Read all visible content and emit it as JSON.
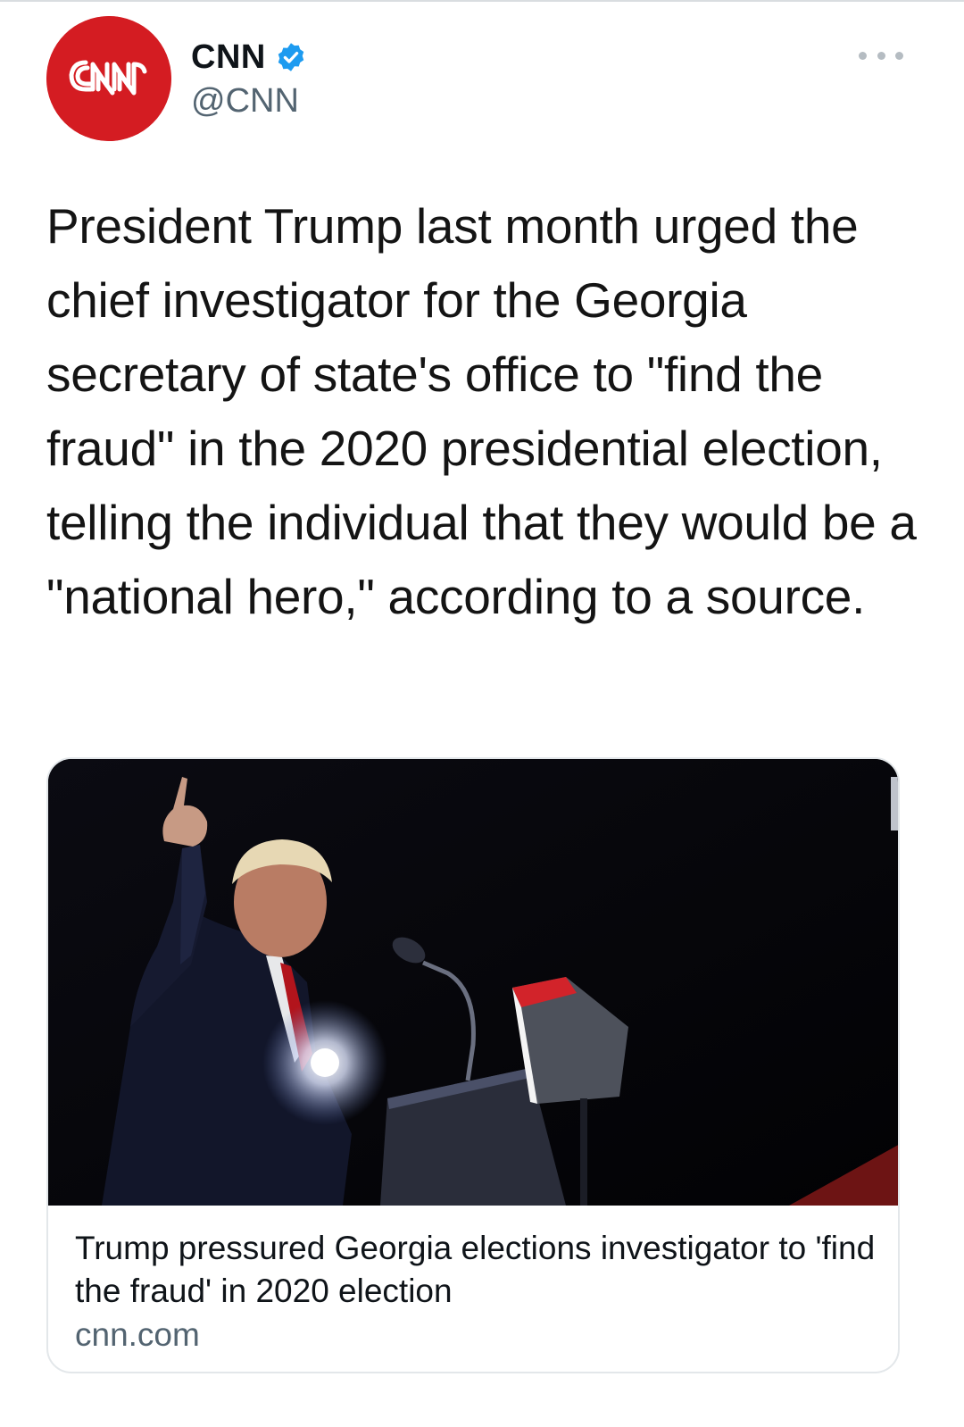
{
  "account": {
    "display_name": "CNN",
    "handle": "@CNN",
    "avatar_label": "CNN",
    "verified": true
  },
  "tweet": {
    "text": "President Trump last month urged the chief investigator for the Georgia secretary of state's office to \"find the fraud\" in the 2020 presidential election, telling the individual that they would be a \"national hero,\" according to a source."
  },
  "card": {
    "image_icon": "photo-speaker-at-podium",
    "title": "Trump pressured Georgia elections investigator to 'find the fraud' in 2020 election",
    "domain": "cnn.com"
  },
  "colors": {
    "brand_red": "#d41c22",
    "verified_blue": "#1d9bf0",
    "secondary_text": "#536471",
    "border": "#e3e7ea"
  }
}
